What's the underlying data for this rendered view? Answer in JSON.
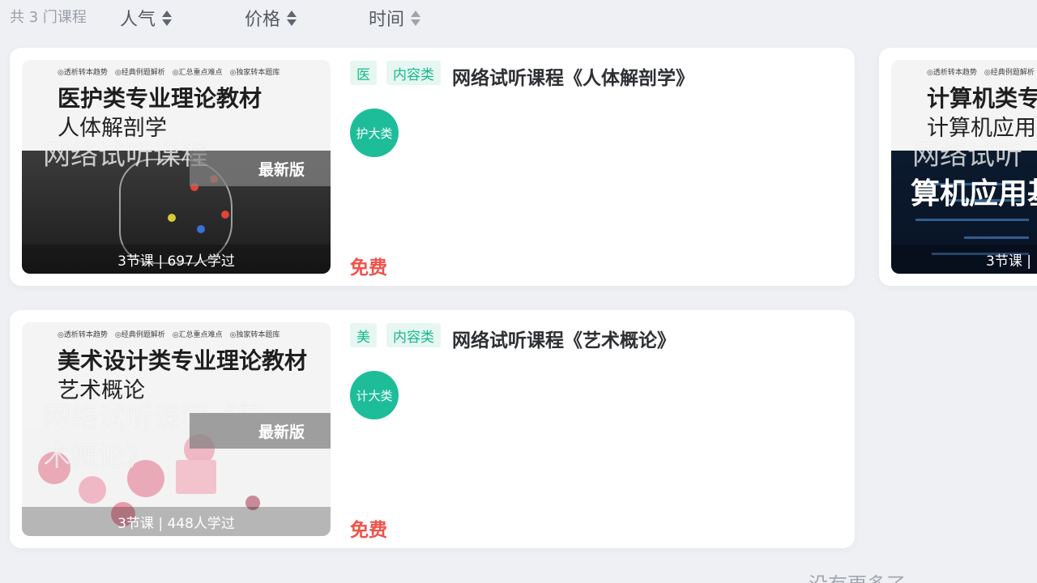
{
  "sort_bar": {
    "total_text": "共 3 门课程",
    "options": [
      {
        "label": "人气"
      },
      {
        "label": "价格"
      },
      {
        "label": "时间"
      }
    ]
  },
  "courses": [
    {
      "cover": {
        "top_tags": "◎透析转本趋势　◎经典例题解析　◎汇总重点难点　◎独家转本题库",
        "book_title": "医护类专业理论教材",
        "book_subtitle": "人体解剖学",
        "watermark": "网络试听课程",
        "edition_badge": "最新版",
        "stats": "3节课 | 697人学过"
      },
      "tags": [
        "医",
        "内容类"
      ],
      "title": "网络试听课程《人体解剖学》",
      "category_circle": "护大类",
      "price": "免费"
    },
    {
      "cover": {
        "top_tags": "◎透析转本趋势　◎经典例题解析　◎汇总重点难点　◎独家转本题库",
        "book_title": "美术设计类专业理论教材",
        "book_subtitle": "艺术概论",
        "watermark": "网络试听课程《艺",
        "watermark_2": "术概论》",
        "edition_badge": "最新版",
        "stats": "3节课 | 448人学过"
      },
      "tags": [
        "美",
        "内容类"
      ],
      "title": "网络试听课程《艺术概论》",
      "category_circle": "计大类",
      "price": "免费"
    },
    {
      "cover": {
        "top_tags": "◎透析转本趋势　◎经典例题解析　◎汇",
        "book_title": "计算机类专",
        "book_subtitle": "计算机应用",
        "watermark": "网络试听",
        "big_text": "算机应用基",
        "stats": "3节课 |"
      }
    }
  ],
  "footer": {
    "no_more": "没有更多了"
  }
}
